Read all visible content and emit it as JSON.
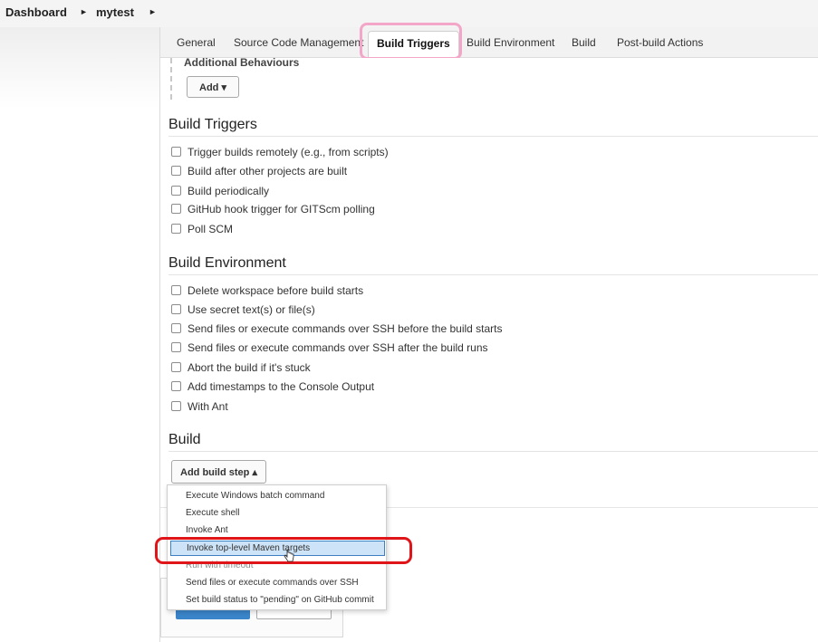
{
  "breadcrumb": {
    "items": [
      "Dashboard",
      "mytest"
    ]
  },
  "tabs": [
    {
      "label": "General"
    },
    {
      "label": "Source Code Management"
    },
    {
      "label": "Build Triggers"
    },
    {
      "label": "Build Environment"
    },
    {
      "label": "Build"
    },
    {
      "label": "Post-build Actions"
    }
  ],
  "additional_behaviours": {
    "title": "Additional Behaviours",
    "add_label": "Add"
  },
  "build_triggers": {
    "title": "Build Triggers",
    "options": [
      "Trigger builds remotely (e.g., from scripts)",
      "Build after other projects are built",
      "Build periodically",
      "GitHub hook trigger for GITScm polling",
      "Poll SCM"
    ]
  },
  "build_environment": {
    "title": "Build Environment",
    "options": [
      "Delete workspace before build starts",
      "Use secret text(s) or file(s)",
      "Send files or execute commands over SSH before the build starts",
      "Send files or execute commands over SSH after the build runs",
      "Abort the build if it's stuck",
      "Add timestamps to the Console Output",
      "With Ant"
    ]
  },
  "build": {
    "title": "Build",
    "add_step_label": "Add build step",
    "menu": [
      "Execute Windows batch command",
      "Execute shell",
      "Invoke Ant",
      "Invoke top-level Maven targets",
      "Run with timeout",
      "Send files or execute commands over SSH",
      "Set build status to \"pending\" on GitHub commit"
    ],
    "highlighted_item": "Invoke top-level Maven targets"
  },
  "colors": {
    "tab_highlight": "#f4a6c8",
    "menu_highlight_box": "#e0151a",
    "menu_selected_bg": "#cde3f7",
    "save_button": "#3a85c9"
  }
}
